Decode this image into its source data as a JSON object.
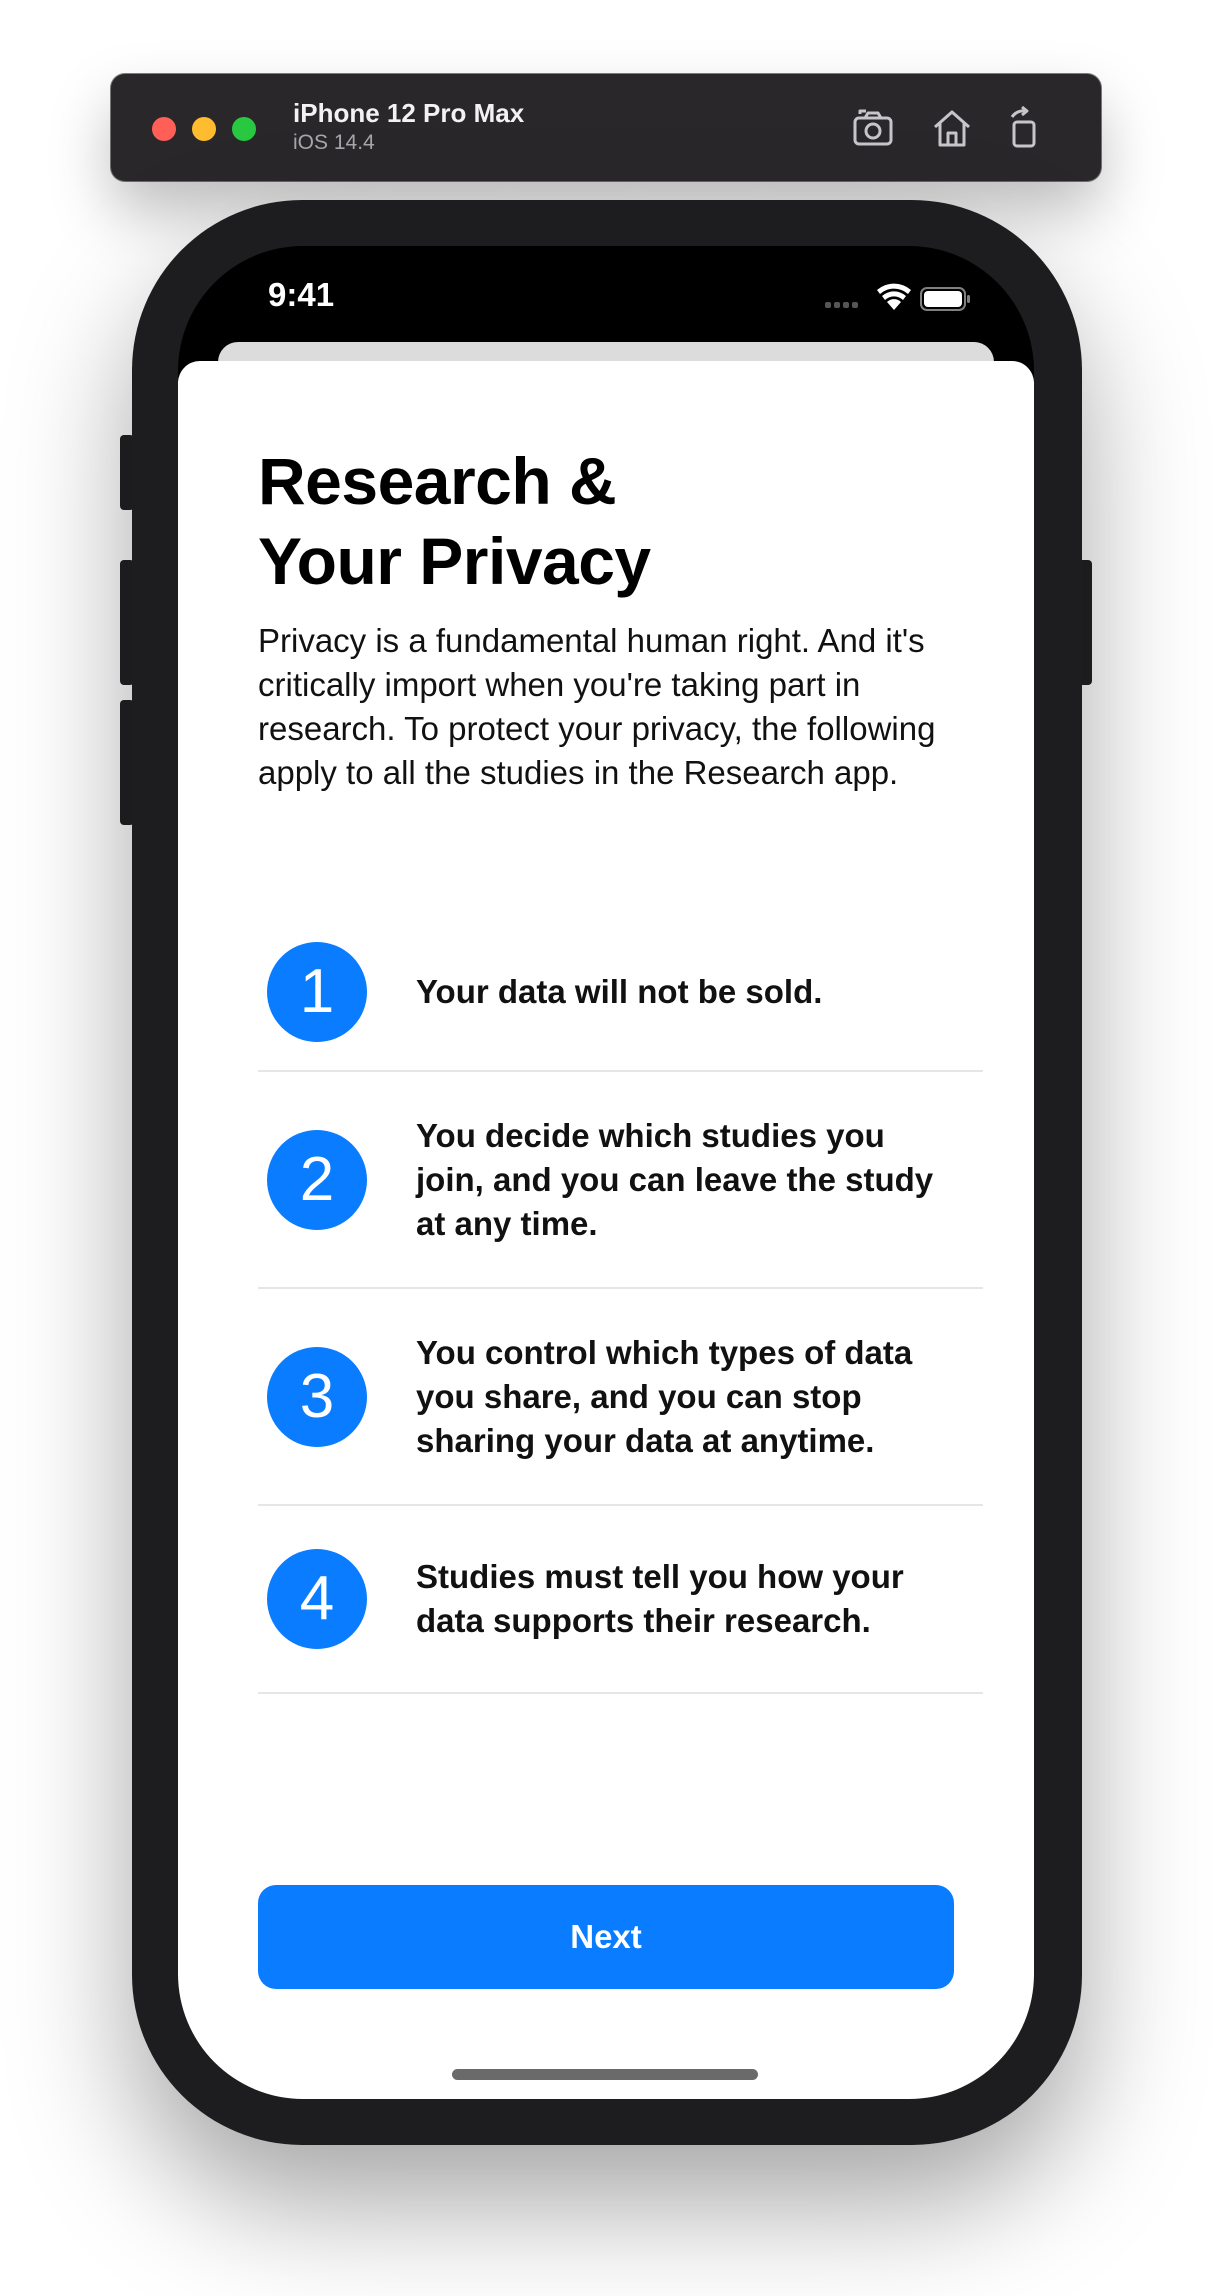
{
  "window": {
    "device_name": "iPhone 12 Pro Max",
    "os_version": "iOS 14.4",
    "toolbar_icons": [
      "screenshot-icon",
      "home-icon",
      "rotate-icon"
    ],
    "traffic_lights": [
      "#fe5f57",
      "#febc2e",
      "#28c840"
    ]
  },
  "status_bar": {
    "time": "9:41",
    "icons": [
      "signal-icon",
      "wifi-icon",
      "battery-icon"
    ]
  },
  "sheet": {
    "title_line1": "Research &",
    "title_line2": "Your Privacy",
    "intro": "Privacy is a fundamental human right. And it's critically import when you're taking part in research. To protect your privacy, the following apply to all the studies in the Research app.",
    "items": [
      {
        "number": "1",
        "text": "Your data will not be sold."
      },
      {
        "number": "2",
        "text": "You decide which studies you join, and you can leave the study at any time."
      },
      {
        "number": "3",
        "text": "You control which types of data you share, and you can stop sharing your data at anytime."
      },
      {
        "number": "4",
        "text": "Studies must tell you how your data supports their research."
      }
    ],
    "next_label": "Next"
  },
  "colors": {
    "accent": "#0a7cff",
    "sheet_background": "#ffffff",
    "device_frame": "#1d1d1f"
  }
}
